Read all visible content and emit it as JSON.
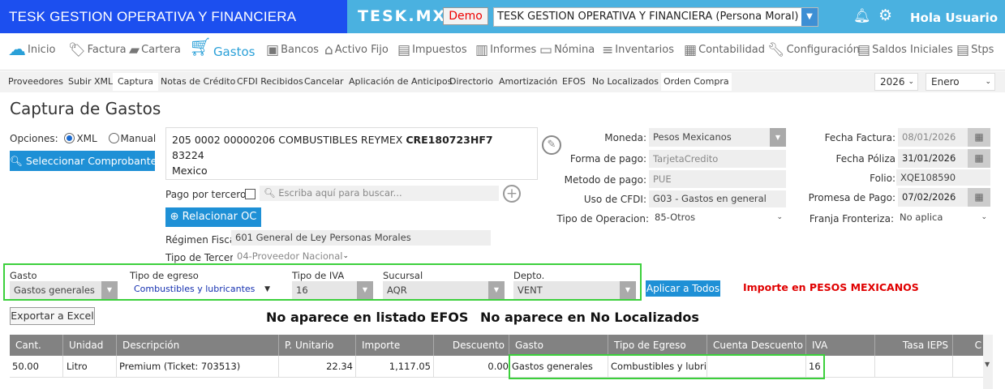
{
  "topbar": {
    "brand": "TESK GESTION OPERATIVA Y FINANCIERA",
    "logo": "TESK.MX",
    "demo": "Demo",
    "company": "TESK GESTION OPERATIVA Y FINANCIERA (Persona Moral)",
    "greeting": "Hola Usuario",
    "colors": {
      "brand_bg": "#1c4fef",
      "bar_bg": "#4ab1e0"
    }
  },
  "modules": [
    "Inicio",
    "Factura",
    "Cartera",
    "Gastos",
    "Bancos",
    "Activo Fijo",
    "Impuestos",
    "Informes",
    "Nómina",
    "Inventarios",
    "Contabilidad",
    "Configuración",
    "Saldos Iniciales",
    "Stps"
  ],
  "subnav": {
    "items": [
      "Proveedores",
      "Subir XML",
      "Captura",
      "Notas de Crédito",
      "CFDI Recibidos",
      "Cancelar",
      "Aplicación de Anticipos",
      "Directorio",
      "Amortización",
      "EFOS",
      "No Localizados",
      "Orden Compra"
    ],
    "year": "2026",
    "month": "Enero"
  },
  "page": {
    "title": "Captura de Gastos",
    "opciones_label": "Opciones:",
    "xml_label": "XML",
    "manual_label": "Manual",
    "select_btn": "Seleccionar Comprobante",
    "supplier": {
      "line1": "205 0002 00000206 COMBUSTIBLES REYMEX",
      "rfc": "CRE180723HF7",
      "line2": "83224",
      "line3": "Mexico"
    },
    "tercero_label": "Pago por tercero?",
    "search_placeholder": "Escriba aquí para buscar...",
    "relacionar_btn": "Relacionar OC",
    "regimen_label": "Régimen Fiscal:",
    "regimen_value": "601 General de Ley Personas Morales",
    "tipo_tercero_label": "Tipo de Tercero:",
    "tipo_tercero_value": "04-Proveedor Nacional"
  },
  "middle": {
    "moneda_label": "Moneda:",
    "moneda_value": "Pesos Mexicanos",
    "forma_label": "Forma de pago:",
    "forma_value": "TarjetaCredito",
    "metodo_label": "Metodo de pago:",
    "metodo_value": "PUE",
    "uso_label": "Uso de CFDI:",
    "uso_value": "G03 - Gastos en general",
    "operacion_label": "Tipo de Operacion:",
    "operacion_value": "85-Otros"
  },
  "right": {
    "fecha_factura_label": "Fecha Factura:",
    "fecha_factura_value": "08/01/2026",
    "fecha_poliza_label": "Fecha Póliza",
    "fecha_poliza_value": "31/01/2026",
    "folio_label": "Folio:",
    "folio_value": "XQE108590",
    "promesa_label": "Promesa de Pago:",
    "promesa_value": "07/02/2026",
    "franja_label": "Franja Fronteriza:",
    "franja_value": "No aplica"
  },
  "gasto_group": {
    "gasto_label": "Gasto",
    "gasto_value": "Gastos generales",
    "egreso_label": "Tipo de egreso",
    "egreso_value": "Combustibles y lubricantes",
    "iva_label": "Tipo de IVA",
    "iva_value": "16",
    "sucursal_label": "Sucursal",
    "sucursal_value": "AQR",
    "depto_label": "Depto.",
    "depto_value": "VENT",
    "apply_btn": "Aplicar a Todos",
    "warning": "Importe en PESOS MEXICANOS"
  },
  "export_btn": "Exportar a Excel",
  "efos_msg": "No aparece en listado EFOS",
  "noloc_msg": "No aparece en No Localizados",
  "table": {
    "headers": [
      "Cant.",
      "Unidad",
      "Descripción",
      "P. Unitario",
      "Importe",
      "Descuento",
      "Gasto",
      "Tipo de Egreso",
      "Cuenta Descuento",
      "IVA",
      "Tasa IEPS",
      "C"
    ],
    "row": [
      "50.00",
      "Litro",
      "Premium (Ticket: 703513)",
      "22.34",
      "1,117.05",
      "0.00",
      "Gastos generales",
      "Combustibles y lubri…",
      "",
      "16",
      "",
      ""
    ]
  }
}
